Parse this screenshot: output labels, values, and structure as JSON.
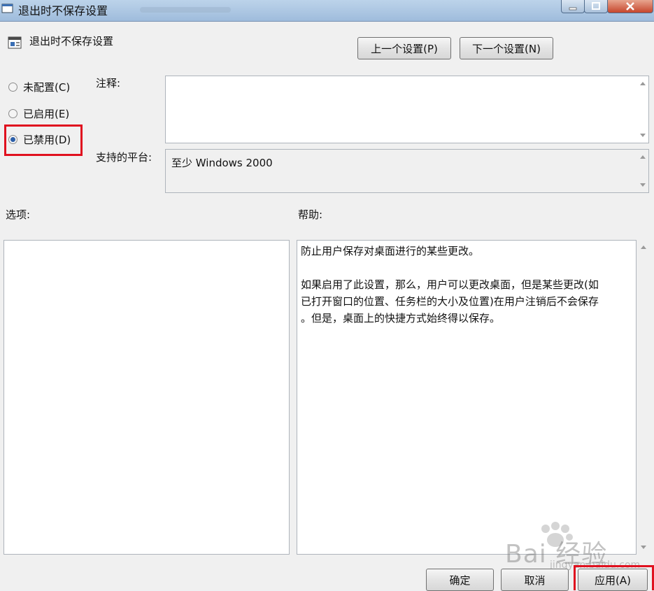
{
  "window": {
    "title": "退出时不保存设置"
  },
  "header": {
    "title": "退出时不保存设置"
  },
  "nav": {
    "prev_label": "上一个设置(P)",
    "next_label": "下一个设置(N)"
  },
  "state": {
    "options": [
      {
        "label": "未配置(C)",
        "checked": false
      },
      {
        "label": "已启用(E)",
        "checked": false
      },
      {
        "label": "已禁用(D)",
        "checked": true
      }
    ]
  },
  "comment": {
    "label": "注释:",
    "value": ""
  },
  "platform": {
    "label": "支持的平台:",
    "value": "至少 Windows 2000"
  },
  "options_panel": {
    "label": "选项:"
  },
  "help_panel": {
    "label": "帮助:",
    "paragraphs": [
      "防止用户保存对桌面进行的某些更改。",
      "如果启用了此设置，那么，用户可以更改桌面，但是某些更改(如\n已打开窗口的位置、任务栏的大小及位置)在用户注销后不会保存\n。但是，桌面上的快捷方式始终得以保存。"
    ]
  },
  "footer": {
    "ok_label": "确定",
    "cancel_label": "取消",
    "apply_label": "应用(A)"
  },
  "watermark": {
    "text": "Bai 经验",
    "sub": "jingyan.baidu.com"
  },
  "colors": {
    "highlight": "#e0111f",
    "accent": "#2b5ea8"
  }
}
